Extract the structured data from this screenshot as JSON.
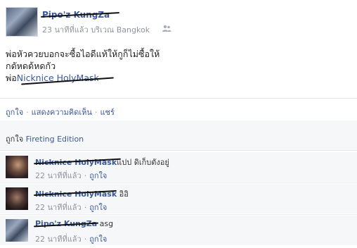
{
  "post": {
    "author": "Pipo'z KungZa",
    "time": "23 นาทีที่แล้ว",
    "location_prefix": "บริเวณ",
    "location": "Bangkok",
    "audience_icon": "friends-icon",
    "body_line1": "พ่อหัวควยบอกจะซื้อไอดีแท้ให้กูก็ไม่ซื้อให้",
    "body_line2": "กดัหดด้หดกัว",
    "body_prefix": "พ่อ",
    "body_tag": "Nicknice HolyMask"
  },
  "actions": {
    "like": "ถูกใจ",
    "comment": "แสดงความคิดเห็น",
    "share": "แชร์"
  },
  "likes": {
    "prefix": "ถูกใจ",
    "name": "Fireting Edition"
  },
  "comments": [
    {
      "author": "Nicknice HolyMask",
      "text": "แปป ดิเก็บตังอยู่",
      "time": "22 นาทีที่แล้ว",
      "like": "ถูกใจ"
    },
    {
      "author": "Nicknice HolyMask",
      "text": "อิอิ",
      "time": "22 นาทีที่แล้ว",
      "like": "ถูกใจ"
    },
    {
      "author": "Pipo'z KungZa",
      "text": "asg",
      "time": "22 นาทีที่แล้ว",
      "like": "ถูกใจ"
    }
  ],
  "separator": "·",
  "colors": {
    "link": "#3b5998",
    "meta": "#90949c",
    "panel": "#f6f7f9"
  }
}
